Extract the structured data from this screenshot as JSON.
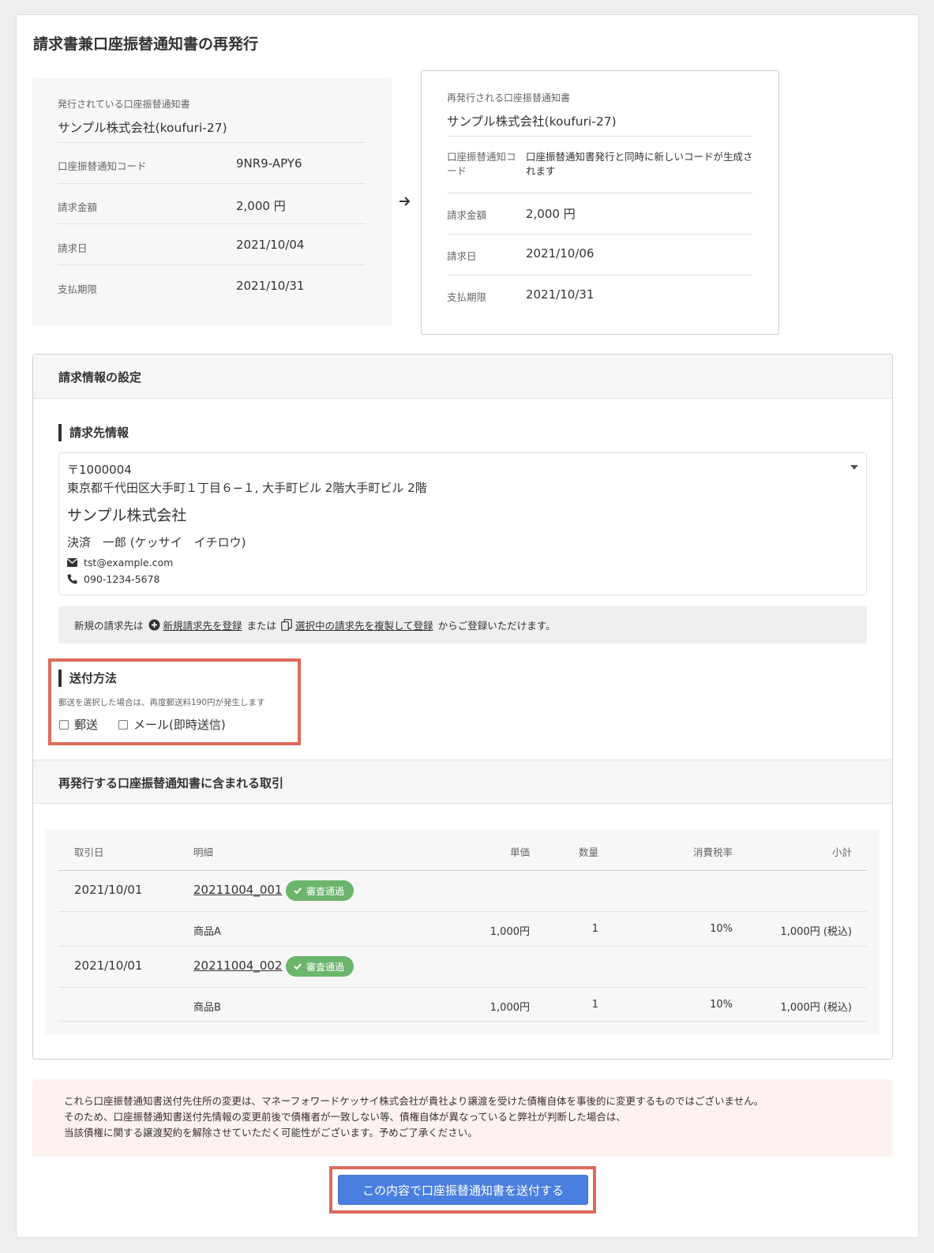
{
  "page_title": "請求書兼口座振替通知書の再発行",
  "current": {
    "label": "発行されている口座振替通知書",
    "company": "サンプル株式会社(koufuri-27)",
    "rows": [
      {
        "key": "口座振替通知コード",
        "value": "9NR9-APY6"
      },
      {
        "key": "請求金額",
        "value": "2,000 円"
      },
      {
        "key": "請求日",
        "value": "2021/10/04"
      },
      {
        "key": "支払期限",
        "value": "2021/10/31"
      }
    ]
  },
  "reissued": {
    "label": "再発行される口座振替通知書",
    "company": "サンプル株式会社(koufuri-27)",
    "rows": [
      {
        "key": "口座振替通知コード",
        "value": "口座振替通知書発行と同時に新しいコードが生成されます"
      },
      {
        "key": "請求金額",
        "value": "2,000 円"
      },
      {
        "key": "請求日",
        "value": "2021/10/06"
      },
      {
        "key": "支払期限",
        "value": "2021/10/31"
      }
    ]
  },
  "settings": {
    "title": "請求情報の設定",
    "billing_heading": "請求先情報",
    "billing": {
      "postal": "〒1000004",
      "address": "東京都千代田区大手町１丁目６−１, 大手町ビル 2階大手町ビル 2階",
      "company": "サンプル株式会社",
      "person": "決済　一郎 (ケッサイ　イチロウ)",
      "email": "tst@example.com",
      "phone": "090-1234-5678"
    },
    "notice": {
      "prefix": "新規の請求先は",
      "link1": "新規請求先を登録",
      "middle": "または",
      "link2": "選択中の請求先を複製して登録",
      "suffix": "からご登録いただけます。"
    },
    "delivery": {
      "heading": "送付方法",
      "note": "郵送を選択した場合は、再度郵送料190円が発生します",
      "options": [
        "郵送",
        "メール(即時送信)"
      ]
    }
  },
  "transactions": {
    "title": "再発行する口座振替通知書に含まれる取引",
    "headers": [
      "取引日",
      "明細",
      "単価",
      "数量",
      "消費税率",
      "小計"
    ],
    "groups": [
      {
        "date": "2021/10/01",
        "id": "20211004_001",
        "badge": "審査通過",
        "item": {
          "name": "商品A",
          "price": "1,000円",
          "qty": "1",
          "tax": "10%",
          "subtotal": "1,000円 (税込)"
        }
      },
      {
        "date": "2021/10/01",
        "id": "20211004_002",
        "badge": "審査通過",
        "item": {
          "name": "商品B",
          "price": "1,000円",
          "qty": "1",
          "tax": "10%",
          "subtotal": "1,000円 (税込)"
        }
      }
    ]
  },
  "warning": [
    "これら口座振替通知書送付先住所の変更は、マネーフォワードケッサイ株式会社が貴社より譲渡を受けた債権自体を事後的に変更するものではございません。",
    "そのため、口座振替通知書送付先情報の変更前後で債権者が一致しない等、債権自体が異なっていると弊社が判断した場合は、",
    "当該債権に関する譲渡契約を解除させていただく可能性がございます。予めご了承ください。"
  ],
  "submit_label": "この内容で口座振替通知書を送付する",
  "colors": {
    "primary": "#4a7fe0",
    "highlight": "#dd6b5c",
    "badge": "#6cb56c",
    "warning_bg": "#fdf2ef"
  }
}
